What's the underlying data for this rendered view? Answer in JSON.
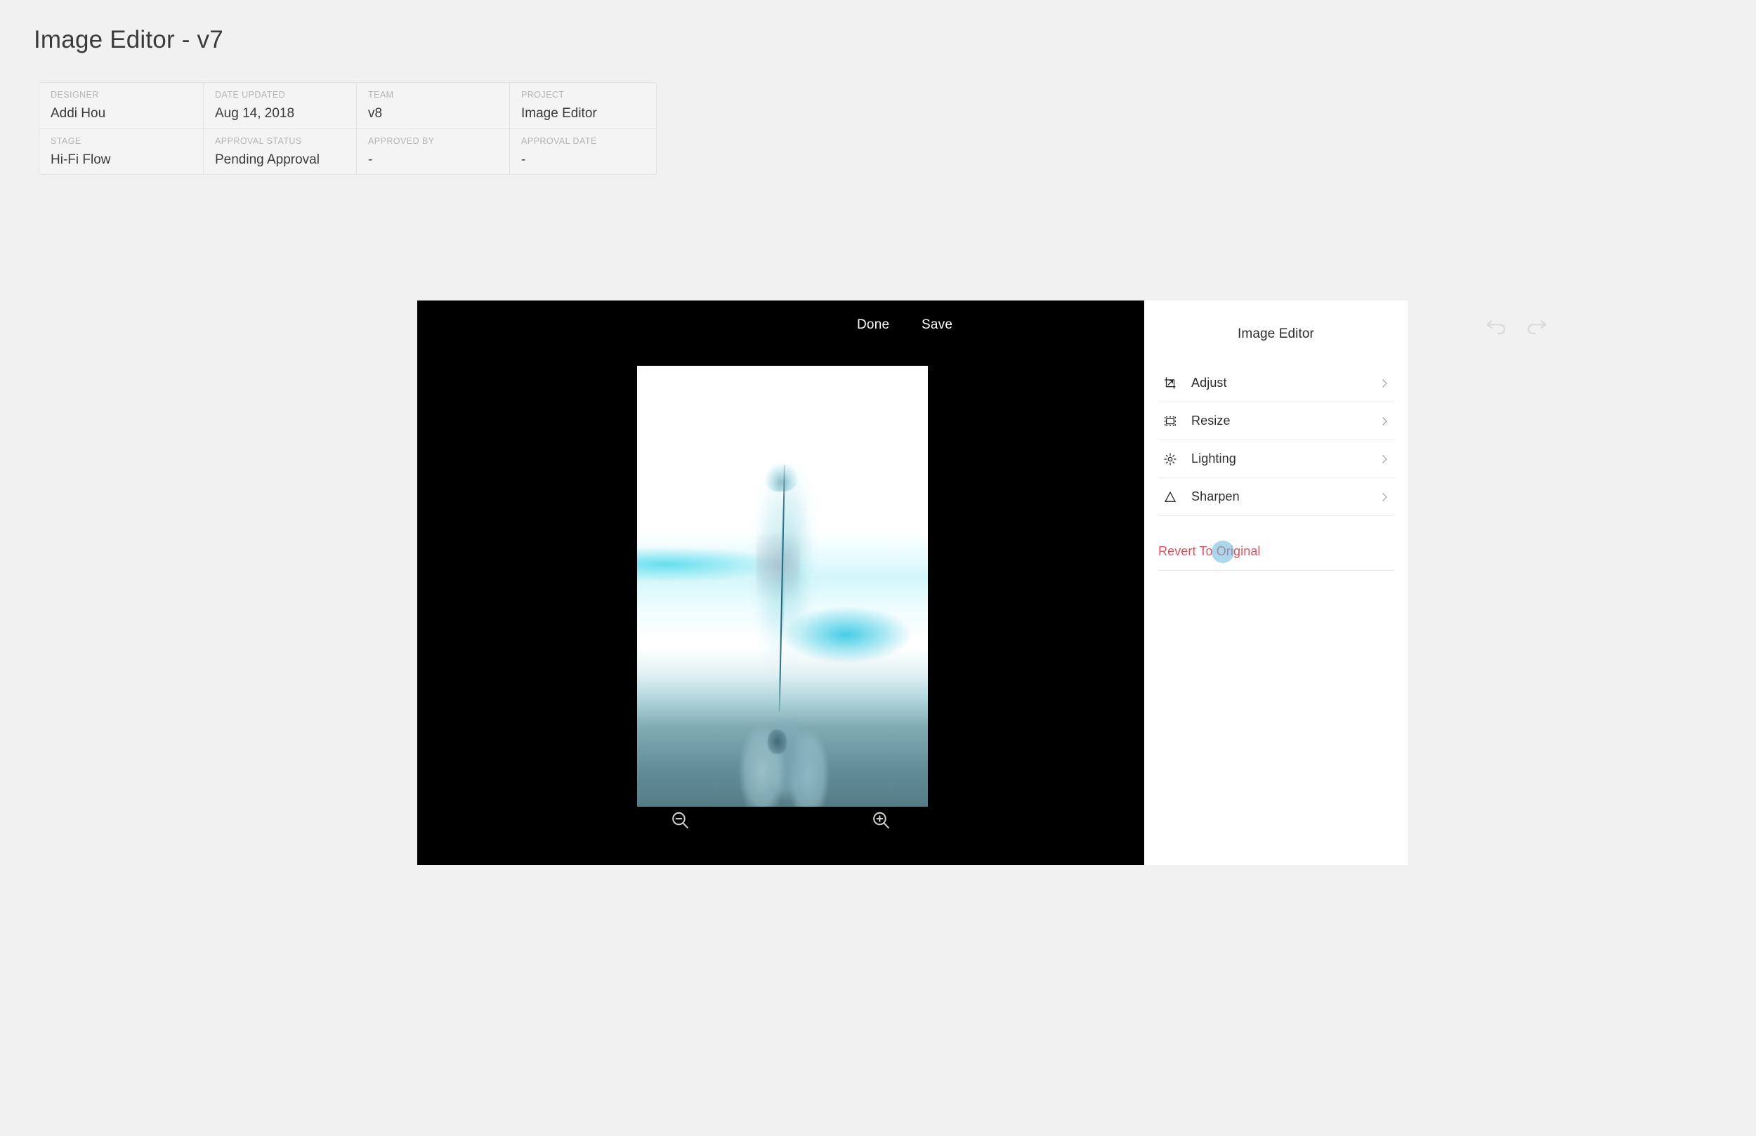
{
  "page": {
    "title": "Image Editor - v7",
    "background_color": "#f1f1f1"
  },
  "meta": {
    "rows": [
      [
        {
          "label": "DESIGNER",
          "value": "Addi Hou"
        },
        {
          "label": "DATE UPDATED",
          "value": "Aug 14, 2018"
        },
        {
          "label": "TEAM",
          "value": "v8"
        },
        {
          "label": "PROJECT",
          "value": "Image Editor"
        }
      ],
      [
        {
          "label": "STAGE",
          "value": "Hi-Fi Flow"
        },
        {
          "label": "APPROVAL STATUS",
          "value": "Pending Approval"
        },
        {
          "label": "APPROVED BY",
          "value": "-"
        },
        {
          "label": "APPROVAL DATE",
          "value": "-"
        }
      ]
    ]
  },
  "editor": {
    "toolbar": {
      "done_label": "Done",
      "save_label": "Save",
      "undo_icon": "undo-icon",
      "redo_icon": "redo-icon"
    },
    "canvas": {
      "background_color": "#000000",
      "photo_description": "hand holding a feather, high-key cyan tinted photo"
    },
    "zoom_controls": {
      "zoom_out_icon": "zoom-out-icon",
      "zoom_in_icon": "zoom-in-icon"
    }
  },
  "panel": {
    "title": "Image Editor",
    "items": [
      {
        "label": "Adjust",
        "icon": "crop-adjust-icon",
        "chevron": "chevron-right-icon"
      },
      {
        "label": "Resize",
        "icon": "resize-icon",
        "chevron": "chevron-right-icon"
      },
      {
        "label": "Lighting",
        "icon": "sun-icon",
        "chevron": "chevron-right-icon"
      },
      {
        "label": "Sharpen",
        "icon": "triangle-icon",
        "chevron": "chevron-right-icon"
      }
    ],
    "revert": {
      "label": "Revert To Original",
      "color": "#e0505c"
    },
    "cursor_highlight_color": "#67b7db"
  }
}
